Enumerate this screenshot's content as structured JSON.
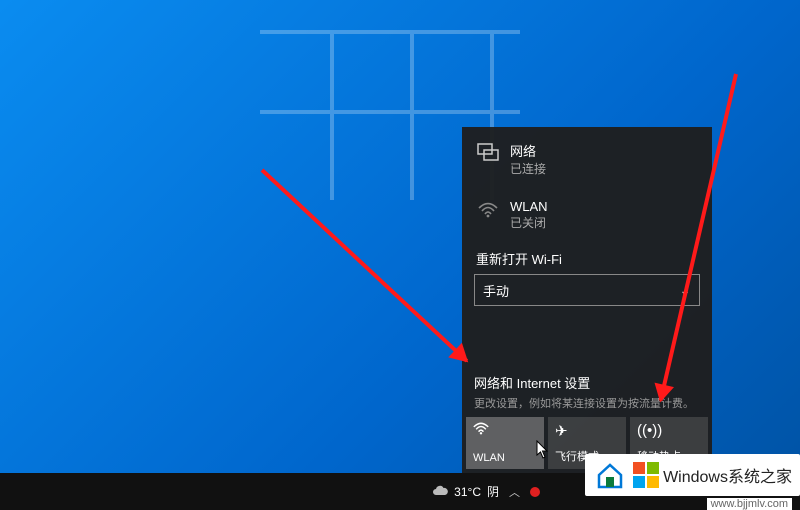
{
  "flyout": {
    "network": {
      "title": "网络",
      "status": "已连接"
    },
    "wlan": {
      "title": "WLAN",
      "status": "已关闭"
    },
    "reopen_label": "重新打开 Wi-Fi",
    "dropdown_value": "手动",
    "settings_title": "网络和 Internet 设置",
    "settings_sub": "更改设置，例如将某连接设置为按流量计费。",
    "tiles": {
      "wlan": "WLAN",
      "airplane": "飞行模式",
      "hotspot": "移动热点"
    }
  },
  "taskbar": {
    "weather_temp": "31°C",
    "weather_cond": "阴"
  },
  "watermark": {
    "text": "Windows系统之家",
    "url": "www.bjjmlv.com"
  }
}
